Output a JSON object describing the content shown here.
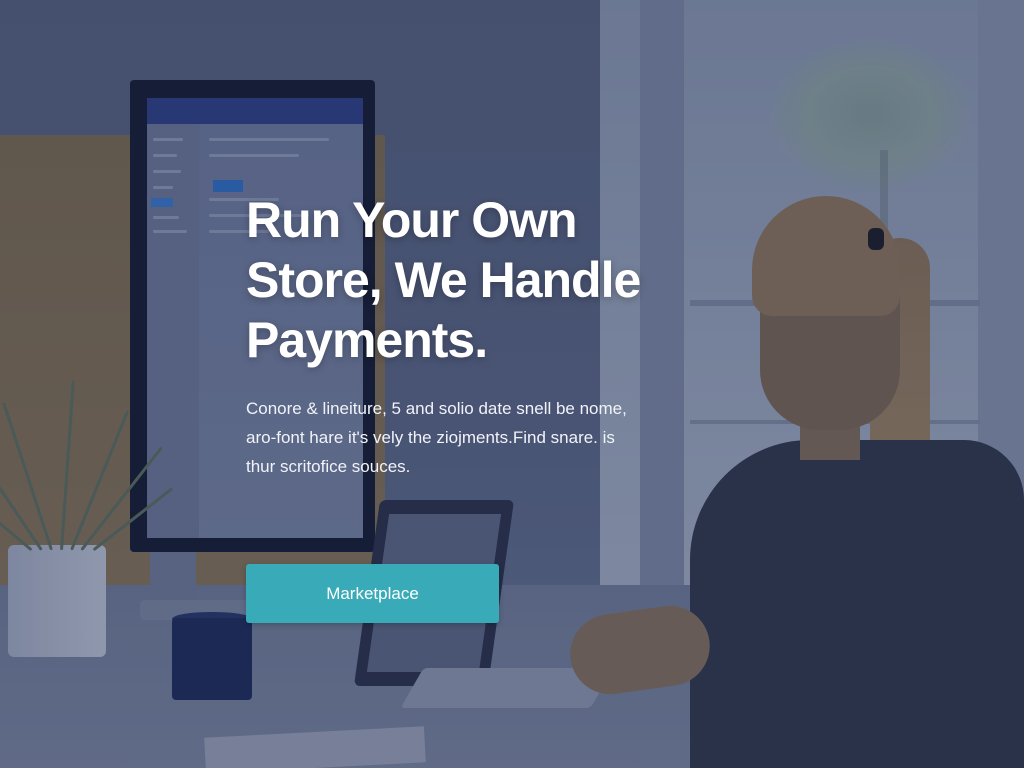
{
  "hero": {
    "headline_lines": [
      "Run Your Own",
      "Store, We Handle",
      "Payments."
    ],
    "subtext_lines": [
      "Conore & lineiture, 5 and solio date snell be nome,",
      "aro-font hare it's vely the ziojments.Find snare. is",
      "thur scritofice souces."
    ],
    "cta_label": "Marketplace",
    "cta_color": "#38aab8"
  }
}
